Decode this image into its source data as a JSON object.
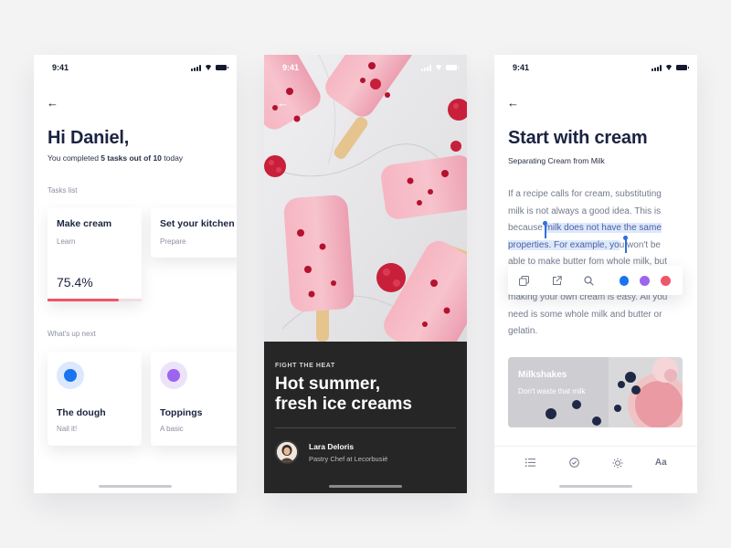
{
  "status_time": "9:41",
  "screen1": {
    "greeting": "Hi Daniel,",
    "summary_prefix": "You completed ",
    "summary_bold": "5 tasks out of 10",
    "summary_suffix": " today",
    "tasks_label": "Tasks list",
    "tasks": [
      {
        "title": "Make cream",
        "tag": "Learn",
        "percent_text": "75.4%",
        "progress": 0.754
      },
      {
        "title": "Set your kitchen",
        "tag": "Prepare"
      }
    ],
    "next_label": "What's up next",
    "next": [
      {
        "title": "The dough",
        "subtitle": "Nail it!",
        "color": "#1a73f0",
        "bg": "#dce8fb"
      },
      {
        "title": "Toppings",
        "subtitle": "A basic",
        "color": "#9c64f0",
        "bg": "#ece3fb"
      }
    ]
  },
  "screen2": {
    "kicker": "FIGHT THE HEAT",
    "headline_line1": "Hot summer,",
    "headline_line2": "fresh ice creams",
    "author": "Lara Deloris",
    "role": "Pastry Chef at Lecorbusié"
  },
  "screen3": {
    "title": "Start with cream",
    "subtitle": "Separating Cream from Milk",
    "para1_l1": "If a recipe calls for cream, substituting",
    "para1_l2": "milk is not always a good idea. This is",
    "para1_l3_pre": "because ",
    "para1_l3_hl": "milk does not have the same",
    "para1_l4_hl": "properties. For example, yo",
    "para1_l4_post": "u won't be",
    "para1_l5": "able to make butter f",
    "para1_l5_b": "om whole milk, but",
    "para2_l1": "making your own cream is easy.  All you",
    "para2_l2": "need is some whole milk and butter or",
    "para2_l3": "gelatin.",
    "colors": [
      "#1a73f0",
      "#9c64f0",
      "#f0566a"
    ],
    "promo_title": "Milkshakes",
    "promo_sub": "Don't waste that milk",
    "bottom_text_btn": "Aa"
  }
}
